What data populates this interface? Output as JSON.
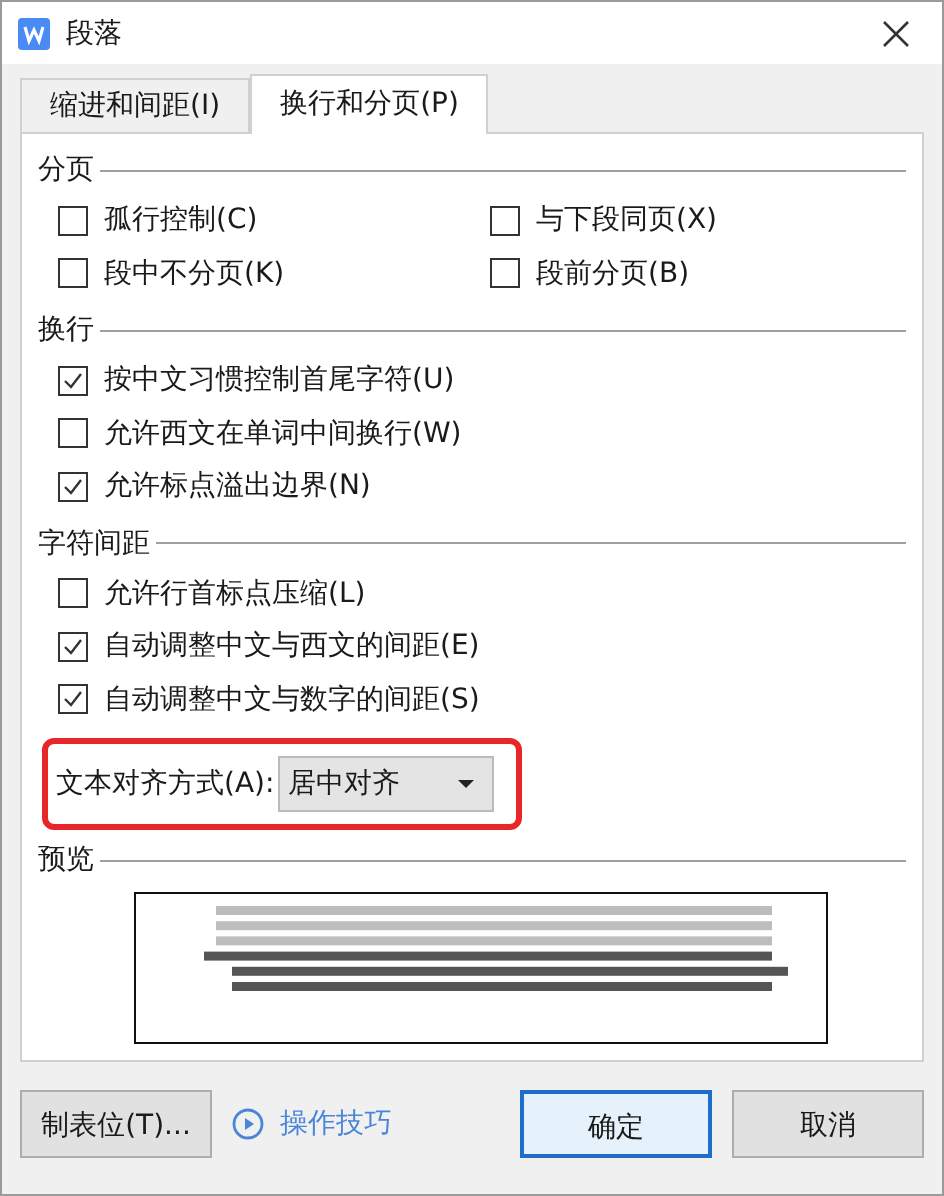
{
  "window": {
    "title": "段落"
  },
  "tabs": [
    {
      "label": "缩进和间距(I)",
      "selected": false
    },
    {
      "label": "换行和分页(P)",
      "selected": true
    }
  ],
  "sections": [
    {
      "title": "分页",
      "kind": "grid",
      "options": [
        {
          "label": "孤行控制(C)",
          "checked": false
        },
        {
          "label": "与下段同页(X)",
          "checked": false
        },
        {
          "label": "段中不分页(K)",
          "checked": false
        },
        {
          "label": "段前分页(B)",
          "checked": false
        }
      ]
    },
    {
      "title": "换行",
      "kind": "list",
      "options": [
        {
          "label": "按中文习惯控制首尾字符(U)",
          "checked": true
        },
        {
          "label": "允许西文在单词中间换行(W)",
          "checked": false
        },
        {
          "label": "允许标点溢出边界(N)",
          "checked": true
        }
      ]
    },
    {
      "title": "字符间距",
      "kind": "list",
      "options": [
        {
          "label": "允许行首标点压缩(L)",
          "checked": false
        },
        {
          "label": "自动调整中文与西文的间距(E)",
          "checked": true
        },
        {
          "label": "自动调整中文与数字的间距(S)",
          "checked": true
        }
      ],
      "alignment": {
        "label": "文本对齐方式(A):",
        "value": "居中对齐"
      }
    }
  ],
  "preview": {
    "title": "预览"
  },
  "buttons": [
    {
      "label": "制表位(T)...",
      "kind": "button"
    },
    {
      "label": "操作技巧",
      "kind": "link"
    },
    {
      "label": "确定",
      "kind": "default"
    },
    {
      "label": "取消",
      "kind": "button"
    }
  ]
}
